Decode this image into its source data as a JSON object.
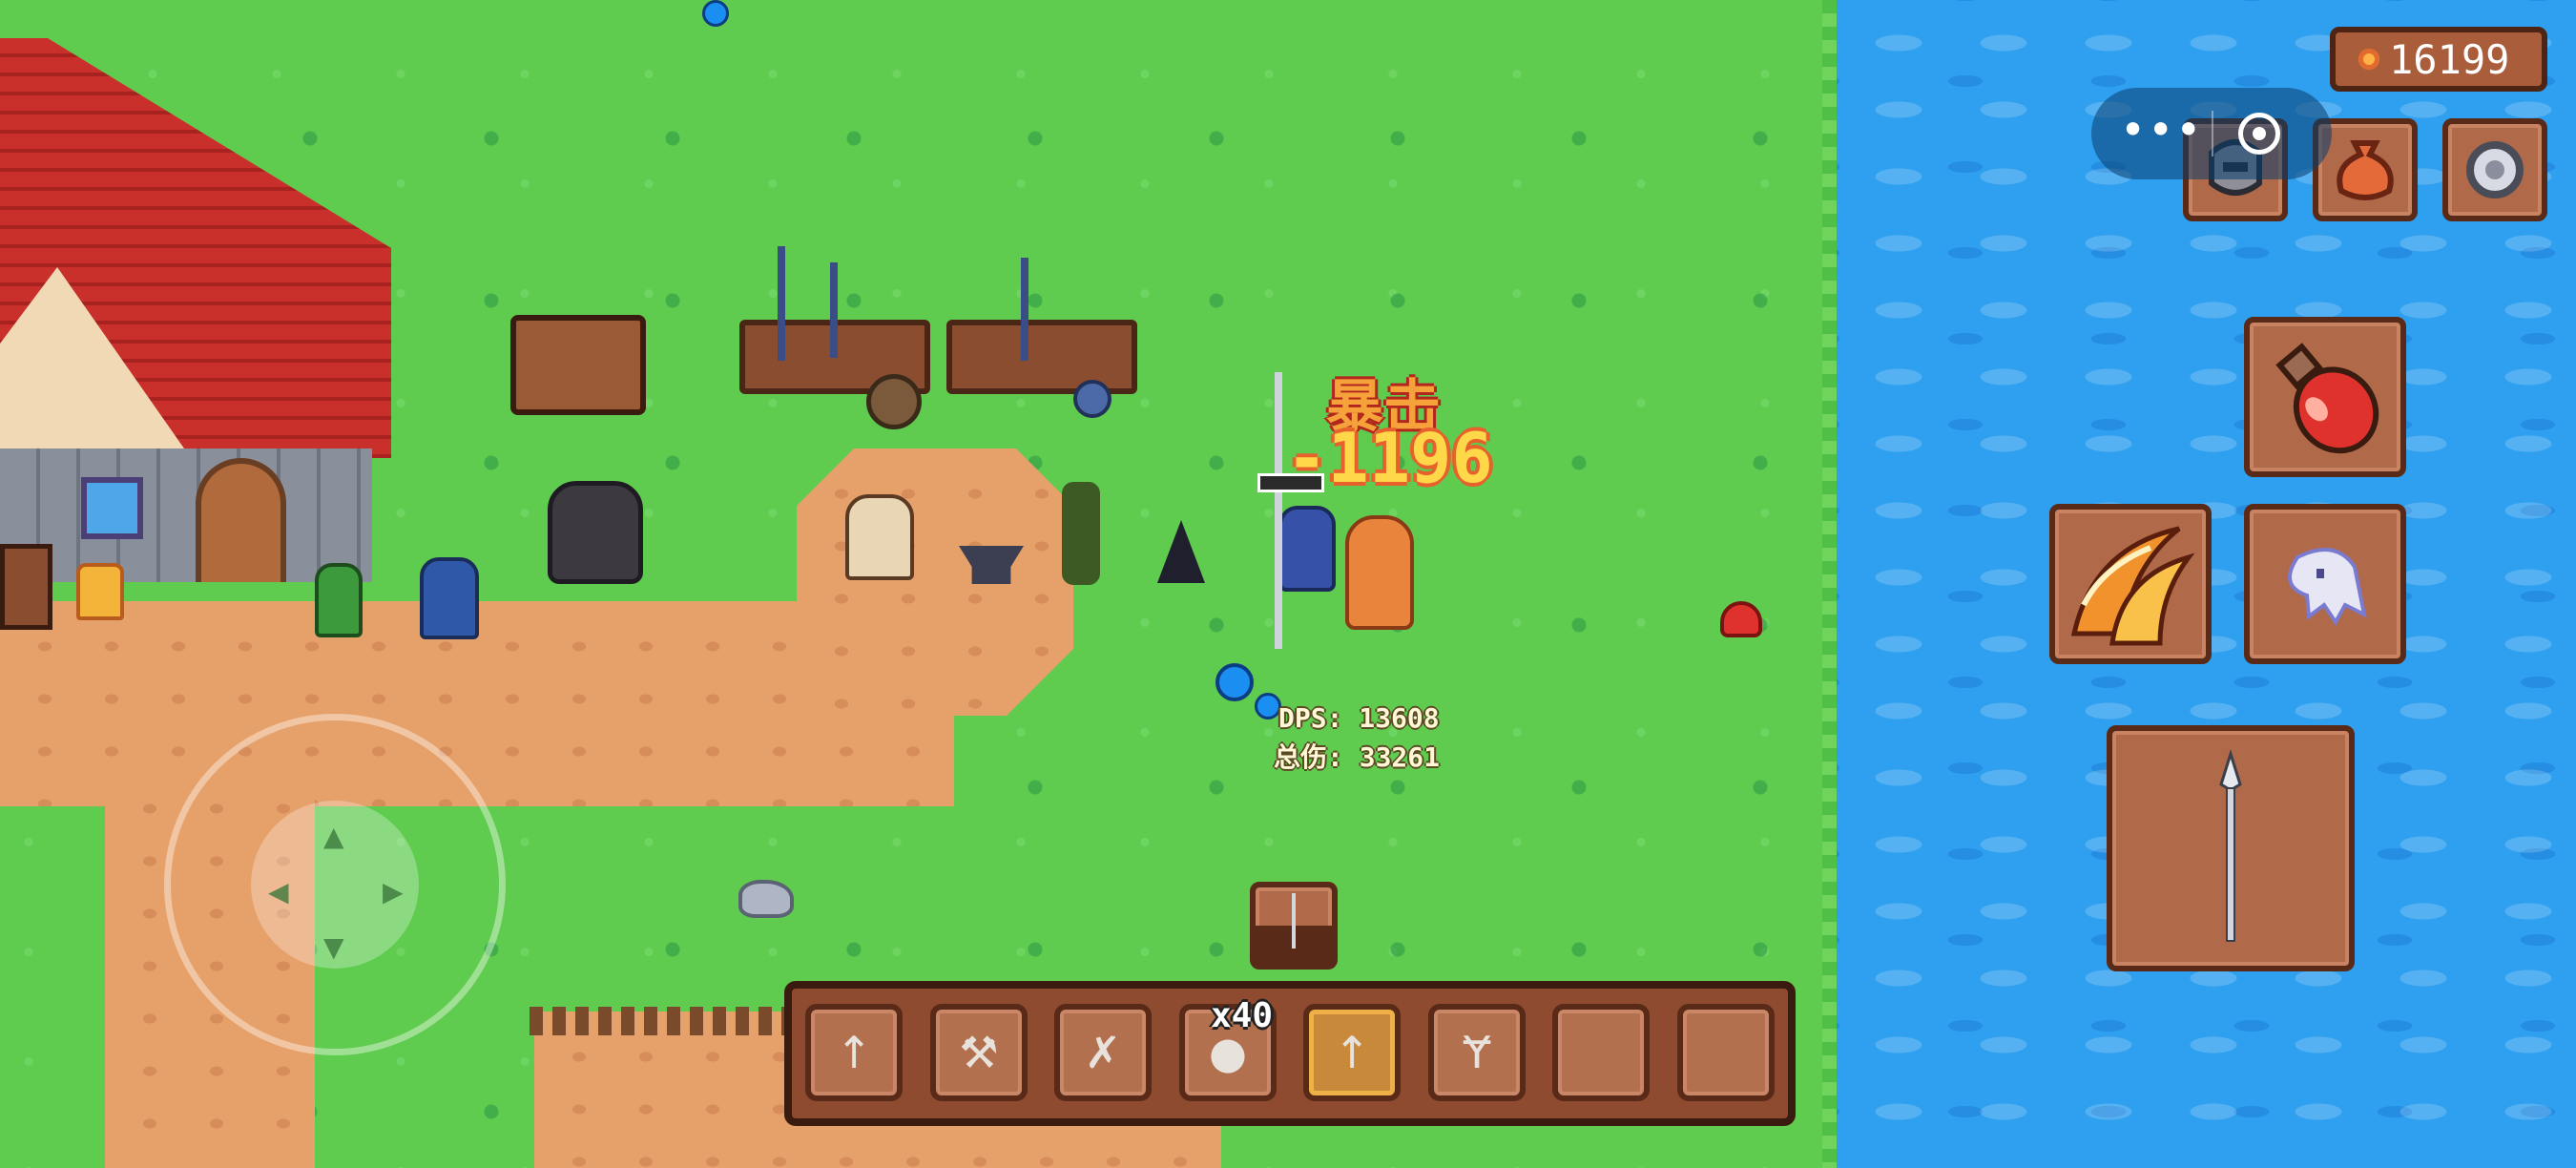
{
  "currency": {
    "value": "16199",
    "icon": "coin-icon"
  },
  "system_capsule": {
    "more_glyph": "•••",
    "close_icon": "target-circle-icon"
  },
  "combat": {
    "crit_label": "暴击",
    "damage": "-1196",
    "dps_text": "DPS: 13608",
    "total_text": "总伤: 33261"
  },
  "top_buttons": [
    {
      "icon": "armor-icon"
    },
    {
      "icon": "loot-bag-icon"
    },
    {
      "icon": "settings-gear-icon"
    }
  ],
  "skills": [
    {
      "icon": "health-potion-icon"
    },
    {
      "icon": "fire-slash-icon"
    },
    {
      "icon": "dash-ghost-icon"
    }
  ],
  "equipped_weapon": {
    "icon": "spear-icon"
  },
  "floating_slot": {
    "icon": "spear-icon"
  },
  "hotbar": {
    "selected_index": 4,
    "slots": [
      {
        "icon": "spear-icon",
        "glyph": "↑",
        "count": ""
      },
      {
        "icon": "axe-icon",
        "glyph": "⚒",
        "count": ""
      },
      {
        "icon": "crossbow-icon",
        "glyph": "✗",
        "count": ""
      },
      {
        "icon": "meat-icon",
        "glyph": "●",
        "count": "x40"
      },
      {
        "icon": "spear-icon",
        "glyph": "↑",
        "count": ""
      },
      {
        "icon": "slingshot-icon",
        "glyph": "Ɏ",
        "count": ""
      },
      {
        "icon": "empty-slot",
        "glyph": "",
        "count": ""
      },
      {
        "icon": "empty-slot",
        "glyph": "",
        "count": ""
      }
    ]
  },
  "joystick": {
    "arrows": [
      "▲",
      "▼",
      "◀",
      "▶"
    ]
  },
  "colors": {
    "grass": "#5fcb4f",
    "water": "#2fa0ef",
    "dirt": "#e6a06a",
    "ui_frame": "#5a2a18",
    "ui_fill": "#b06a4a"
  }
}
